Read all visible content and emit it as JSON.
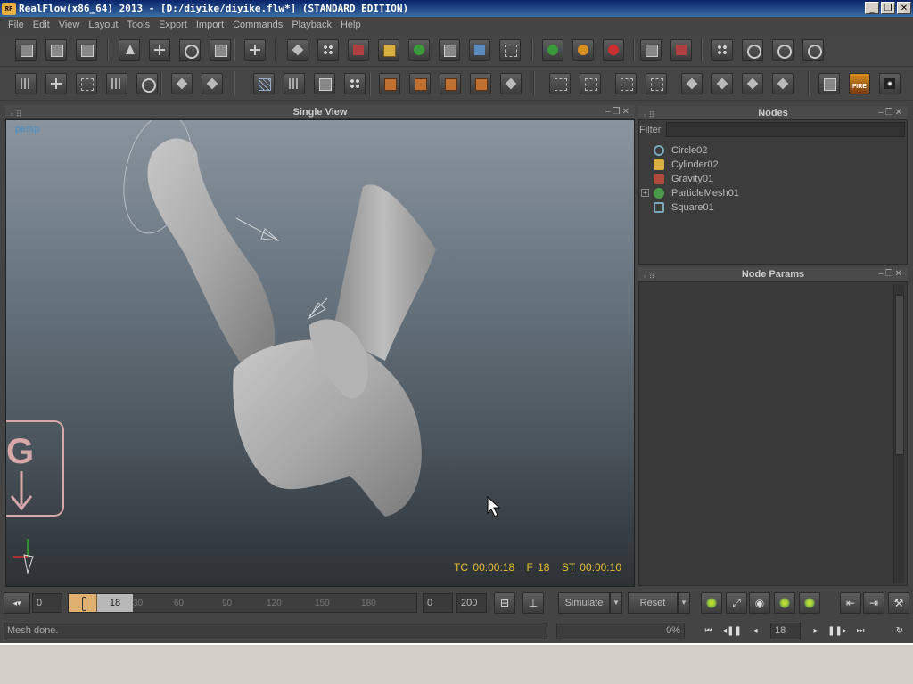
{
  "window": {
    "title": "RealFlow(x86_64) 2013 - [D:/diyike/diyike.flw*] (STANDARD EDITION)",
    "app_icon_text": "RF",
    "minimize": "_",
    "maximize": "❐",
    "close": "✕"
  },
  "menu": [
    "File",
    "Edit",
    "View",
    "Layout",
    "Tools",
    "Export",
    "Import",
    "Commands",
    "Playback",
    "Help"
  ],
  "viewport": {
    "title": "Single View",
    "camera_label": "persp",
    "gravity_label": "G",
    "hud": {
      "timecode": "TC 00:00:18",
      "frame": "F 18",
      "sim_time": "ST 00:00:10"
    },
    "colors": {
      "accent": "#e8c030",
      "camera": "#4a90c8",
      "gravity": "#d8a8a8"
    }
  },
  "nodes_panel": {
    "title": "Nodes",
    "filter_label": "Filter",
    "filter_value": "",
    "items": [
      {
        "label": "Circle02",
        "icon": "circle-emitter-icon",
        "expandable": false
      },
      {
        "label": "Cylinder02",
        "icon": "cylinder-object-icon",
        "expandable": false
      },
      {
        "label": "Gravity01",
        "icon": "gravity-daemon-icon",
        "expandable": false
      },
      {
        "label": "ParticleMesh01",
        "icon": "particle-mesh-icon",
        "expandable": true
      },
      {
        "label": "Square01",
        "icon": "square-emitter-icon",
        "expandable": false
      }
    ]
  },
  "params_panel": {
    "title": "Node Params"
  },
  "timeline": {
    "start_value": "0",
    "current_frame": "18",
    "ticks": [
      "0",
      "30",
      "60",
      "90",
      "120",
      "150",
      "180"
    ],
    "range_start": "0",
    "range_end": "200",
    "simulate_label": "Simulate",
    "reset_label": "Reset"
  },
  "status": {
    "message": "Mesh done.",
    "progress_text": "0%",
    "playback_frame": "18"
  }
}
